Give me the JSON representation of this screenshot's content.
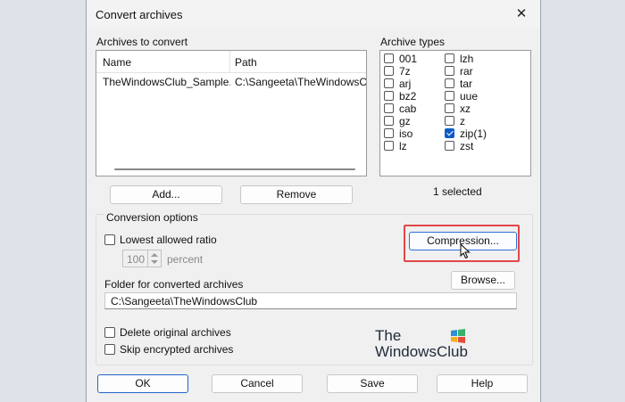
{
  "dialog": {
    "title": "Convert archives",
    "close_glyph": "✕"
  },
  "archives": {
    "label": "Archives to convert",
    "columns": [
      "Name",
      "Path"
    ],
    "rows": [
      {
        "name": "TheWindowsClub_Sample.zip",
        "path": "C:\\Sangeeta\\TheWindowsClub\\"
      }
    ],
    "add_label": "Add...",
    "remove_label": "Remove"
  },
  "types": {
    "label": "Archive types",
    "items": [
      {
        "label": "001",
        "checked": false
      },
      {
        "label": "7z",
        "checked": false
      },
      {
        "label": "arj",
        "checked": false
      },
      {
        "label": "bz2",
        "checked": false
      },
      {
        "label": "cab",
        "checked": false
      },
      {
        "label": "gz",
        "checked": false
      },
      {
        "label": "iso",
        "checked": false
      },
      {
        "label": "lz",
        "checked": false
      },
      {
        "label": "lzh",
        "checked": false
      },
      {
        "label": "rar",
        "checked": false
      },
      {
        "label": "tar",
        "checked": false
      },
      {
        "label": "uue",
        "checked": false
      },
      {
        "label": "xz",
        "checked": false
      },
      {
        "label": "z",
        "checked": false
      },
      {
        "label": "zip(1)",
        "checked": true
      },
      {
        "label": "zst",
        "checked": false
      }
    ],
    "selected_text": "1 selected"
  },
  "options": {
    "label": "Conversion options",
    "lowest_ratio_label": "Lowest allowed ratio",
    "lowest_ratio_checked": false,
    "ratio_value": "100",
    "percent_label": "percent",
    "compression_label": "Compression...",
    "folder_label": "Folder for converted archives",
    "browse_label": "Browse...",
    "folder_value": "C:\\Sangeeta\\TheWindowsClub",
    "delete_originals_label": "Delete original archives",
    "delete_originals_checked": false,
    "skip_encrypted_label": "Skip encrypted archives",
    "skip_encrypted_checked": false
  },
  "watermark": {
    "line1": "The",
    "line2": "WindowsClub"
  },
  "footer": {
    "ok": "OK",
    "cancel": "Cancel",
    "save": "Save",
    "help": "Help"
  },
  "colors": {
    "accent": "#0d5cc6",
    "highlight": "#e1474a"
  }
}
